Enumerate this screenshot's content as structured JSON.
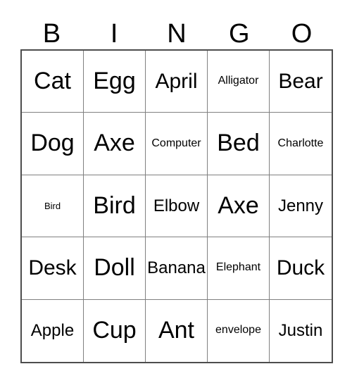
{
  "card": {
    "title_letters": [
      "B",
      "I",
      "N",
      "G",
      "O"
    ],
    "grid": {
      "rows": 5,
      "columns": 5,
      "border_color": "#4d4d4d",
      "gridline_color": "#808080",
      "background_color": "#ffffff",
      "text_color": "#000000"
    },
    "cells": [
      [
        {
          "text": "Cat",
          "size": "xl"
        },
        {
          "text": "Egg",
          "size": "xl"
        },
        {
          "text": "April",
          "size": "lg"
        },
        {
          "text": "Alligator",
          "size": "sm"
        },
        {
          "text": "Bear",
          "size": "lg"
        }
      ],
      [
        {
          "text": "Dog",
          "size": "xl"
        },
        {
          "text": "Axe",
          "size": "xl"
        },
        {
          "text": "Computer",
          "size": "sm"
        },
        {
          "text": "Bed",
          "size": "xl"
        },
        {
          "text": "Charlotte",
          "size": "sm"
        }
      ],
      [
        {
          "text": "Bird",
          "size": "xs"
        },
        {
          "text": "Bird",
          "size": "xl"
        },
        {
          "text": "Elbow",
          "size": "md"
        },
        {
          "text": "Axe",
          "size": "xl"
        },
        {
          "text": "Jenny",
          "size": "md"
        }
      ],
      [
        {
          "text": "Desk",
          "size": "lg"
        },
        {
          "text": "Doll",
          "size": "xl"
        },
        {
          "text": "Banana",
          "size": "md"
        },
        {
          "text": "Elephant",
          "size": "sm"
        },
        {
          "text": "Duck",
          "size": "lg"
        }
      ],
      [
        {
          "text": "Apple",
          "size": "md"
        },
        {
          "text": "Cup",
          "size": "xl"
        },
        {
          "text": "Ant",
          "size": "xl"
        },
        {
          "text": "envelope",
          "size": "sm"
        },
        {
          "text": "Justin",
          "size": "md"
        }
      ]
    ]
  }
}
